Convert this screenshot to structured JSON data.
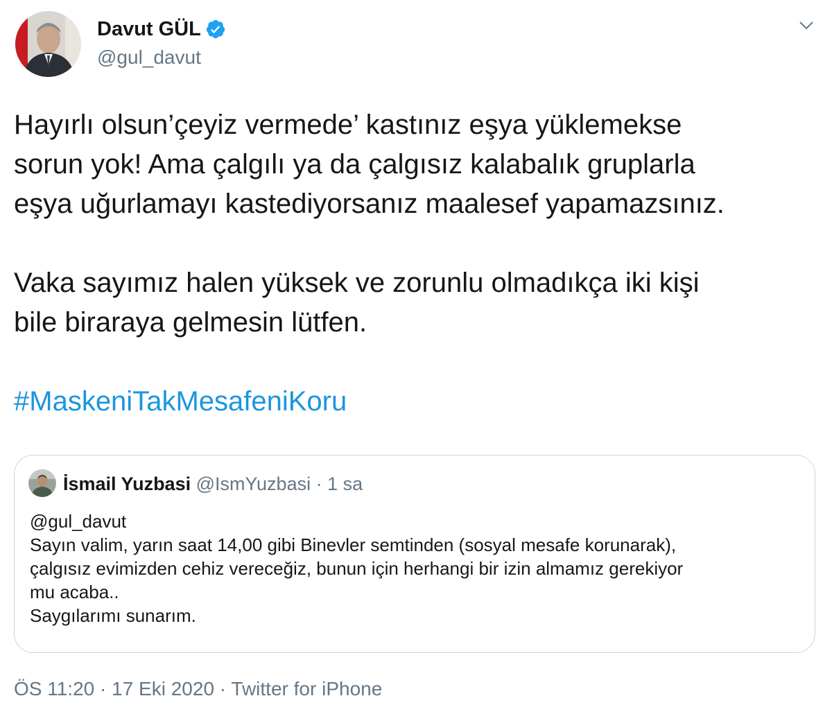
{
  "author": {
    "name": "Davut GÜL",
    "handle": "@gul_davut",
    "verified_icon": "verified-badge-icon",
    "accent": "#1da1f2"
  },
  "menu_icon": "chevron-down-icon",
  "tweet": {
    "lines": [
      "Hayırlı olsun’çeyiz vermede’ kastınız eşya yüklemekse",
      "sorun yok! Ama çalgılı ya da çalgısız kalabalık gruplarla",
      "eşya uğurlamayı kastediyorsanız maalesef yapamazsınız.",
      "Vaka sayımız halen yüksek ve zorunlu olmadıkça iki kişi",
      "bile biraraya gelmesin lütfen."
    ],
    "hashtag": "#MaskeniTakMesafeniKoru",
    "hashtag_color": "#1b95e0"
  },
  "quoted": {
    "name": "İsmail Yuzbasi",
    "handle": "@IsmYuzbasi",
    "separator": "·",
    "time": "1 sa",
    "lines": [
      "@gul_davut",
      "Sayın valim, yarın saat 14,00 gibi Binevler semtinden (sosyal mesafe korunarak),",
      "çalgısız evimizden cehiz vereceğiz, bunun için herhangi bir izin almamız gerekiyor",
      "mu acaba..",
      "Saygılarımı sunarım."
    ]
  },
  "footer": {
    "time": "ÖS 11:20",
    "sep1": "·",
    "date": "17 Eki 2020",
    "sep2": "·",
    "source": "Twitter for iPhone"
  },
  "colors": {
    "text": "#14171a",
    "secondary": "#657786",
    "border": "#ccd6dd"
  }
}
